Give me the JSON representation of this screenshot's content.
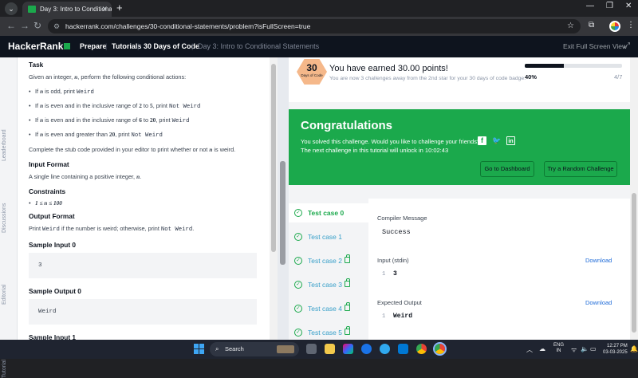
{
  "browser": {
    "tab_title": "Day 3: Intro to Conditional Stat",
    "url": "hackerrank.com/challenges/30-conditional-statements/problem?isFullScreen=true"
  },
  "header": {
    "logo": "HackerRank",
    "nav": [
      "Prepare",
      "Tutorials",
      "30 Days of Code"
    ],
    "breadcrumb_current": "Day 3: Intro to Conditional Statements",
    "exit_fullscreen": "Exit Full Screen View"
  },
  "sidebar_tabs": [
    "Leaderboard",
    "Discussions",
    "Editorial",
    "Tutorial"
  ],
  "problem": {
    "task_heading": "Task",
    "task_intro_a": "Given an integer, ",
    "var_n": "n",
    "task_intro_b": ", perform the following conditional actions:",
    "rules": [
      {
        "pre": "If ",
        "var": "n",
        "mid": " is odd, print ",
        "out": "Weird"
      },
      {
        "pre": "If ",
        "var": "n",
        "mid": " is even and in the inclusive range of ",
        "r1": "2",
        "to": " to ",
        "r2": "5",
        "mid2": ", print ",
        "out": "Not Weird"
      },
      {
        "pre": "If ",
        "var": "n",
        "mid": " is even and in the inclusive range of ",
        "r1": "6",
        "to": " to ",
        "r2": "20",
        "mid2": ", print ",
        "out": "Weird"
      },
      {
        "pre": "If ",
        "var": "n",
        "mid": " is even and greater than ",
        "r1": "20",
        "mid2": ", print ",
        "out": "Not Weird"
      }
    ],
    "stub_a": "Complete the stub code provided in your editor to print whether or not ",
    "stub_b": " is weird.",
    "input_heading": "Input Format",
    "input_text": "A single line containing a positive integer, ",
    "constraints_heading": "Constraints",
    "constraint": "1 ≤ n ≤ 100",
    "output_heading": "Output Format",
    "output_a": "Print ",
    "output_weird": "Weird",
    "output_b": " if the number is weird; otherwise, print ",
    "output_notweird": "Not Weird",
    "sample_in0_heading": "Sample Input 0",
    "sample_in0": "3",
    "sample_out0_heading": "Sample Output 0",
    "sample_out0": "Weird",
    "sample_in1_heading": "Sample Input 1"
  },
  "points": {
    "badge_number": "30",
    "badge_sub": "Days of Code",
    "earned": "You have earned 30.00 points!",
    "away": "You are now 3 challenges away from the 2nd star for your 30 days of code badge.",
    "percent": "40%",
    "fraction": "4/7",
    "progress": 0.4
  },
  "congrats": {
    "title": "Congratulations",
    "solved": "You solved this challenge. Would you like to challenge your friends?",
    "next": "The next challenge in this tutorial will unlock in 10:02:43",
    "btn_dashboard": "Go to Dashboard",
    "btn_random": "Try a Random Challenge"
  },
  "testcases": [
    "Test case 0",
    "Test case 1",
    "Test case 2",
    "Test case 3",
    "Test case 4",
    "Test case 5"
  ],
  "result": {
    "compiler_label": "Compiler Message",
    "compiler_msg": "Success",
    "input_label": "Input (stdin)",
    "input_val": "3",
    "expected_label": "Expected Output",
    "expected_val": "Weird",
    "download": "Download",
    "line1": "1"
  },
  "taskbar": {
    "search": "Search",
    "lang1": "ENG",
    "lang2": "IN",
    "time": "12:27 PM",
    "date": "03-03-2025"
  }
}
